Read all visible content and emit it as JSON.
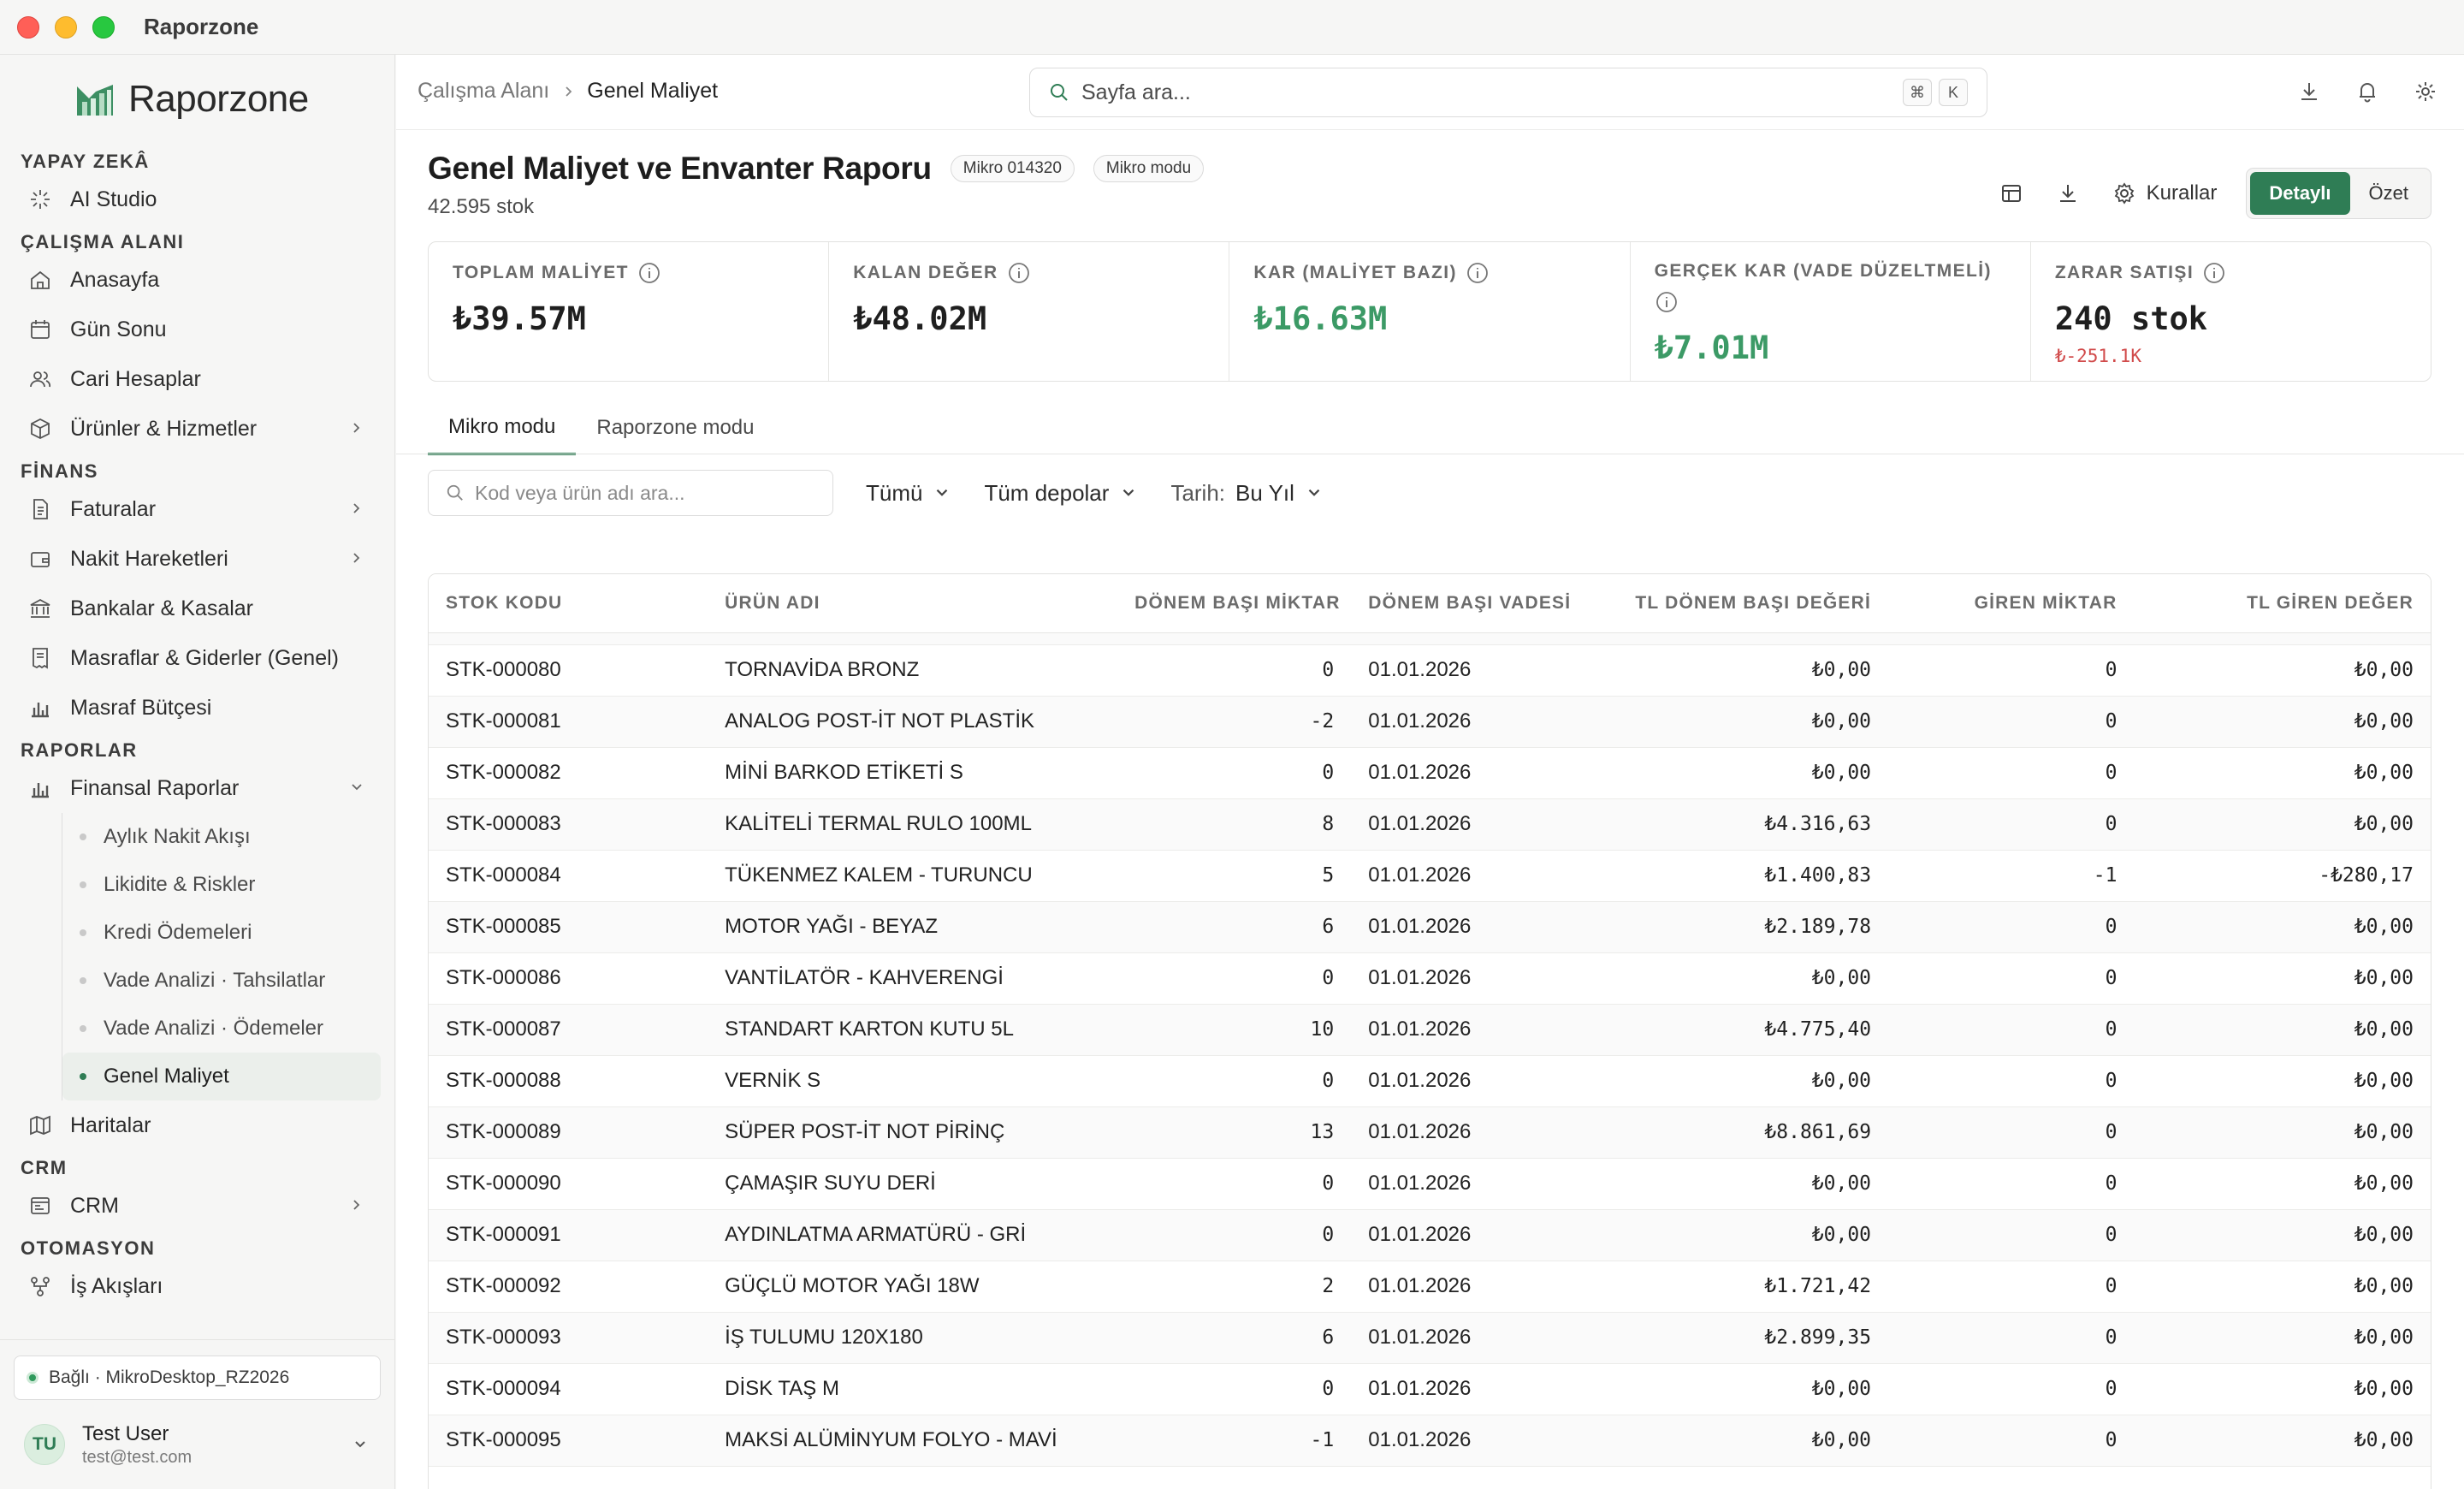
{
  "window": {
    "title": "Raporzone"
  },
  "brand": {
    "name": "Raporzone"
  },
  "sidebar": {
    "sections": [
      {
        "title": "YAPAY ZEKÂ",
        "items": [
          {
            "label": "AI Studio",
            "icon": "sparkle-icon"
          }
        ]
      },
      {
        "title": "ÇALIŞMA ALANI",
        "items": [
          {
            "label": "Anasayfa",
            "icon": "home-icon"
          },
          {
            "label": "Gün Sonu",
            "icon": "calendar-icon"
          },
          {
            "label": "Cari Hesaplar",
            "icon": "users-icon"
          },
          {
            "label": "Ürünler & Hizmetler",
            "icon": "box-icon",
            "chevron": true
          }
        ]
      },
      {
        "title": "FİNANS",
        "items": [
          {
            "label": "Faturalar",
            "icon": "file-icon",
            "chevron": true
          },
          {
            "label": "Nakit Hareketleri",
            "icon": "wallet-icon",
            "chevron": true
          },
          {
            "label": "Bankalar & Kasalar",
            "icon": "bank-icon"
          },
          {
            "label": "Masraflar & Giderler (Genel)",
            "icon": "receipt-icon"
          },
          {
            "label": "Masraf Bütçesi",
            "icon": "bar-chart-icon"
          }
        ]
      },
      {
        "title": "RAPORLAR",
        "items": [
          {
            "label": "Finansal Raporlar",
            "icon": "bar-chart-icon",
            "expanded": true
          }
        ]
      }
    ],
    "report_sub_items": [
      {
        "label": "Aylık Nakit Akışı",
        "active": false
      },
      {
        "label": "Likidite & Riskler",
        "active": false
      },
      {
        "label": "Kredi Ödemeleri",
        "active": false
      },
      {
        "label": "Vade Analizi · Tahsilatlar",
        "active": false
      },
      {
        "label": "Vade Analizi · Ödemeler",
        "active": false
      },
      {
        "label": "Genel Maliyet",
        "active": true
      }
    ],
    "after_reports": {
      "label": "Haritalar",
      "icon": "map-icon"
    },
    "crm_section": {
      "title": "CRM",
      "item": {
        "label": "CRM",
        "icon": "crm-icon"
      }
    },
    "automation_section": {
      "title": "OTOMASYON",
      "item": {
        "label": "İş Akışları",
        "icon": "workflow-icon"
      }
    },
    "connection": "Bağlı · MikroDesktop_RZ2026",
    "user": {
      "initials": "TU",
      "name": "Test User",
      "email": "test@test.com"
    }
  },
  "topbar": {
    "breadcrumb": [
      "Çalışma Alanı",
      "Genel Maliyet"
    ],
    "search_placeholder": "Sayfa ara...",
    "shortcut": [
      "⌘",
      "K"
    ]
  },
  "page": {
    "title": "Genel Maliyet ve Envanter Raporu",
    "chips": [
      "Mikro 014320",
      "Mikro modu"
    ],
    "subtitle": "42.595 stok",
    "actions": {
      "rules_label": "Kurallar"
    },
    "view_toggle": {
      "options": [
        "Detaylı",
        "Özet"
      ],
      "selected": "Detaylı"
    }
  },
  "kpis": [
    {
      "label": "TOPLAM MALİYET",
      "value": "₺39.57M",
      "tone": "default"
    },
    {
      "label": "KALAN DEĞER",
      "value": "₺48.02M",
      "tone": "default"
    },
    {
      "label": "KAR (MALİYET BAZI)",
      "value": "₺16.63M",
      "tone": "green"
    },
    {
      "label": "GERÇEK KAR (VADE DÜZELTMELİ)",
      "value": "₺7.01M",
      "tone": "green"
    },
    {
      "label": "ZARAR SATIŞI",
      "value": "240 stok",
      "sub": "₺-251.1K",
      "tone": "default"
    }
  ],
  "tabs": [
    {
      "label": "Mikro modu",
      "active": true
    },
    {
      "label": "Raporzone modu",
      "active": false
    }
  ],
  "filters": {
    "search_placeholder": "Kod veya ürün adı ara...",
    "type": "Tümü",
    "warehouse": "Tüm depolar",
    "date_label": "Tarih:",
    "date_value": "Bu Yıl"
  },
  "table": {
    "columns": [
      "STOK KODU",
      "ÜRÜN ADI",
      "DÖNEM BAŞI MİKTAR",
      "DÖNEM BAŞI VADESİ",
      "TL DÖNEM BAŞI DEĞERİ",
      "GİREN MİKTAR",
      "TL GİREN DEĞER"
    ],
    "rows": [
      [
        "STK-000080",
        "TORNAVİDA BRONZ",
        "0",
        "01.01.2026",
        "₺0,00",
        "0",
        "₺0,00"
      ],
      [
        "STK-000081",
        "ANALOG POST-İT NOT PLASTİK",
        "-2",
        "01.01.2026",
        "₺0,00",
        "0",
        "₺0,00"
      ],
      [
        "STK-000082",
        "MİNİ BARKOD ETİKETİ S",
        "0",
        "01.01.2026",
        "₺0,00",
        "0",
        "₺0,00"
      ],
      [
        "STK-000083",
        "KALİTELİ TERMAL RULO 100ML",
        "8",
        "01.01.2026",
        "₺4.316,63",
        "0",
        "₺0,00"
      ],
      [
        "STK-000084",
        "TÜKENMEZ KALEM - TURUNCU",
        "5",
        "01.01.2026",
        "₺1.400,83",
        "-1",
        "-₺280,17"
      ],
      [
        "STK-000085",
        "MOTOR YAĞI - BEYAZ",
        "6",
        "01.01.2026",
        "₺2.189,78",
        "0",
        "₺0,00"
      ],
      [
        "STK-000086",
        "VANTİLATÖR - KAHVERENGİ",
        "0",
        "01.01.2026",
        "₺0,00",
        "0",
        "₺0,00"
      ],
      [
        "STK-000087",
        "STANDART KARTON KUTU 5L",
        "10",
        "01.01.2026",
        "₺4.775,40",
        "0",
        "₺0,00"
      ],
      [
        "STK-000088",
        "VERNİK S",
        "0",
        "01.01.2026",
        "₺0,00",
        "0",
        "₺0,00"
      ],
      [
        "STK-000089",
        "SÜPER POST-İT NOT PİRİNÇ",
        "13",
        "01.01.2026",
        "₺8.861,69",
        "0",
        "₺0,00"
      ],
      [
        "STK-000090",
        "ÇAMAŞIR SUYU DERİ",
        "0",
        "01.01.2026",
        "₺0,00",
        "0",
        "₺0,00"
      ],
      [
        "STK-000091",
        "AYDINLATMA ARMATÜRÜ - GRİ",
        "0",
        "01.01.2026",
        "₺0,00",
        "0",
        "₺0,00"
      ],
      [
        "STK-000092",
        "GÜÇLÜ MOTOR YAĞI 18W",
        "2",
        "01.01.2026",
        "₺1.721,42",
        "0",
        "₺0,00"
      ],
      [
        "STK-000093",
        "İŞ TULUMU 120X180",
        "6",
        "01.01.2026",
        "₺2.899,35",
        "0",
        "₺0,00"
      ],
      [
        "STK-000094",
        "DİSK TAŞ M",
        "0",
        "01.01.2026",
        "₺0,00",
        "0",
        "₺0,00"
      ],
      [
        "STK-000095",
        "MAKSİ ALÜMİNYUM FOLYO - MAVİ",
        "-1",
        "01.01.2026",
        "₺0,00",
        "0",
        "₺0,00"
      ]
    ]
  },
  "colors": {
    "accent": "#2f7d55",
    "positive": "#3c9a66",
    "negative": "#d14b4b"
  }
}
